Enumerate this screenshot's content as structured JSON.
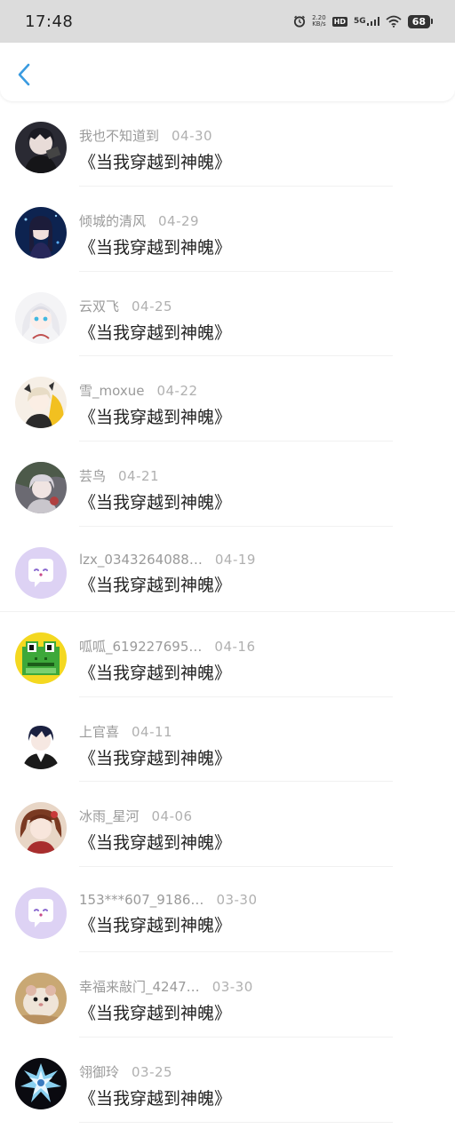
{
  "status_bar": {
    "time": "17:48",
    "net_speed": "2.20",
    "net_unit": "KB/s",
    "hd": "HD",
    "network": "5G",
    "battery": "68"
  },
  "nav": {
    "back_icon": "chevron-left-icon",
    "accent": "#3a9be0"
  },
  "items": [
    {
      "username": "我也不知道到",
      "date": "04-30",
      "title": "《当我穿越到神魄》",
      "avatar": "anime-boy-dark"
    },
    {
      "username": "倾城的清风",
      "date": "04-29",
      "title": "《当我穿越到神魄》",
      "avatar": "anime-girl-blue"
    },
    {
      "username": "云双飞",
      "date": "04-25",
      "title": "《当我穿越到神魄》",
      "avatar": "anime-girl-white"
    },
    {
      "username": "雪_moxue",
      "date": "04-22",
      "title": "《当我穿越到神魄》",
      "avatar": "anime-girl-yellow"
    },
    {
      "username": "芸鸟",
      "date": "04-21",
      "title": "《当我穿越到神魄》",
      "avatar": "anime-girl-grey"
    },
    {
      "username": "lzx_0343264088…",
      "date": "04-19",
      "title": "《当我穿越到神魄》",
      "avatar": "default-chat-bubble"
    },
    {
      "username": "呱呱_619227695…",
      "date": "04-16",
      "title": "《当我穿越到神魄》",
      "avatar": "pixel-frog"
    },
    {
      "username": "上官喜",
      "date": "04-11",
      "title": "《当我穿越到神魄》",
      "avatar": "anime-boy-navy"
    },
    {
      "username": "冰雨_星河",
      "date": "04-06",
      "title": "《当我穿越到神魄》",
      "avatar": "anime-girl-brown"
    },
    {
      "username": "153***607_9186…",
      "date": "03-30",
      "title": "《当我穿越到神魄》",
      "avatar": "default-chat-bubble"
    },
    {
      "username": "幸福来敲门_4247…",
      "date": "03-30",
      "title": "《当我穿越到神魄》",
      "avatar": "hamster"
    },
    {
      "username": "翎御玲",
      "date": "03-25",
      "title": "《当我穿越到神魄》",
      "avatar": "crystal-dark"
    }
  ]
}
